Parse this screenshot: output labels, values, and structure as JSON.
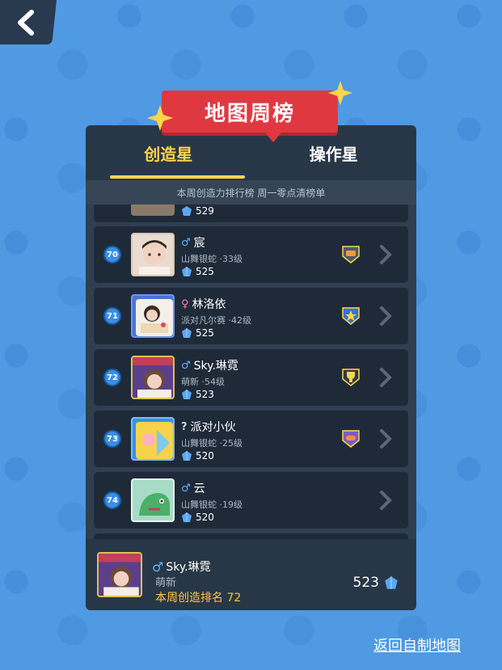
{
  "title": "地图周榜",
  "tabs": [
    {
      "label": "创造星",
      "active": true
    },
    {
      "label": "操作星",
      "active": false
    }
  ],
  "subtitle": "本周创造力排行榜 周一零点清榜单",
  "partial_row": {
    "score": "529"
  },
  "rows": [
    {
      "rank": "70",
      "gender": "male",
      "gender_symbol": "♂",
      "name": "宸",
      "meta": "山舞银蛇 ·33级",
      "score": "525",
      "badge": "orange-shield-badge"
    },
    {
      "rank": "71",
      "gender": "female",
      "gender_symbol": "♀",
      "name": "林洛依",
      "meta": "派对凡尔赛 ·42级",
      "score": "525",
      "badge": "star-shield-badge"
    },
    {
      "rank": "72",
      "gender": "male",
      "gender_symbol": "♂",
      "name": "Sky.琳霓",
      "meta": "萌新 ·54级",
      "score": "523",
      "badge": "trophy-shield-badge"
    },
    {
      "rank": "73",
      "gender": "unknown",
      "gender_symbol": "?",
      "name": "派对小伙",
      "meta": "山舞银蛇 ·25级",
      "score": "520",
      "badge": "pill-shield-badge"
    },
    {
      "rank": "74",
      "gender": "male",
      "gender_symbol": "♂",
      "name": "云",
      "meta": "山舞银蛇 ·19级",
      "score": "520",
      "badge": ""
    }
  ],
  "footer": {
    "gender_symbol": "♂",
    "name": "Sky.琳霓",
    "meta": "萌新",
    "rank_text": "本周创造排名 72",
    "score": "523"
  },
  "return_link": "返回自制地图",
  "colors": {
    "accent": "#ffd54a",
    "banner": "#e03840",
    "panel": "#283747",
    "row": "#1f2a39",
    "gem": "#5aa6f2"
  }
}
